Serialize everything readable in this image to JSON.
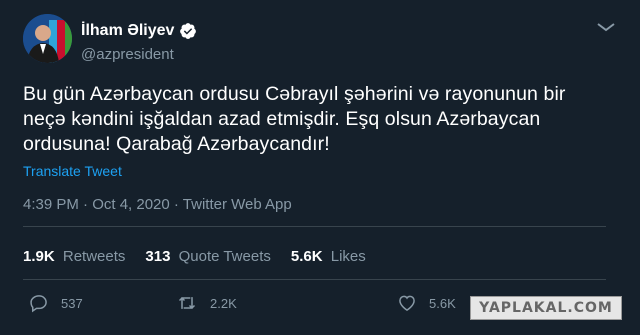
{
  "author": {
    "name": "İlham Əliyev",
    "handle": "@azpresident",
    "verified": true,
    "avatar_icon": "avatar-photo-icon"
  },
  "tweet": {
    "text": "Bu gün Azərbaycan ordusu Cəbrayıl şəhərini  və rayonunun bir neçə kəndini işğaldan azad etmişdir. Eşq olsun Azərbaycan ordusuna! Qarabağ Azərbaycandır!",
    "translate_label": "Translate Tweet",
    "meta": "4:39 PM · Oct 4, 2020 · Twitter Web App"
  },
  "stats": {
    "retweets_count": "1.9K",
    "retweets_label": "Retweets",
    "quotes_count": "313",
    "quotes_label": "Quote Tweets",
    "likes_count": "5.6K",
    "likes_label": "Likes"
  },
  "actions": {
    "reply_count": "537",
    "retweet_count": "2.2K",
    "like_count": "5.6K"
  },
  "watermark": "YAPLAKAL.COM",
  "colors": {
    "background": "#15202b",
    "text": "#ffffff",
    "secondary": "#8899a6",
    "link": "#1da1f2",
    "divider": "#38444d"
  }
}
